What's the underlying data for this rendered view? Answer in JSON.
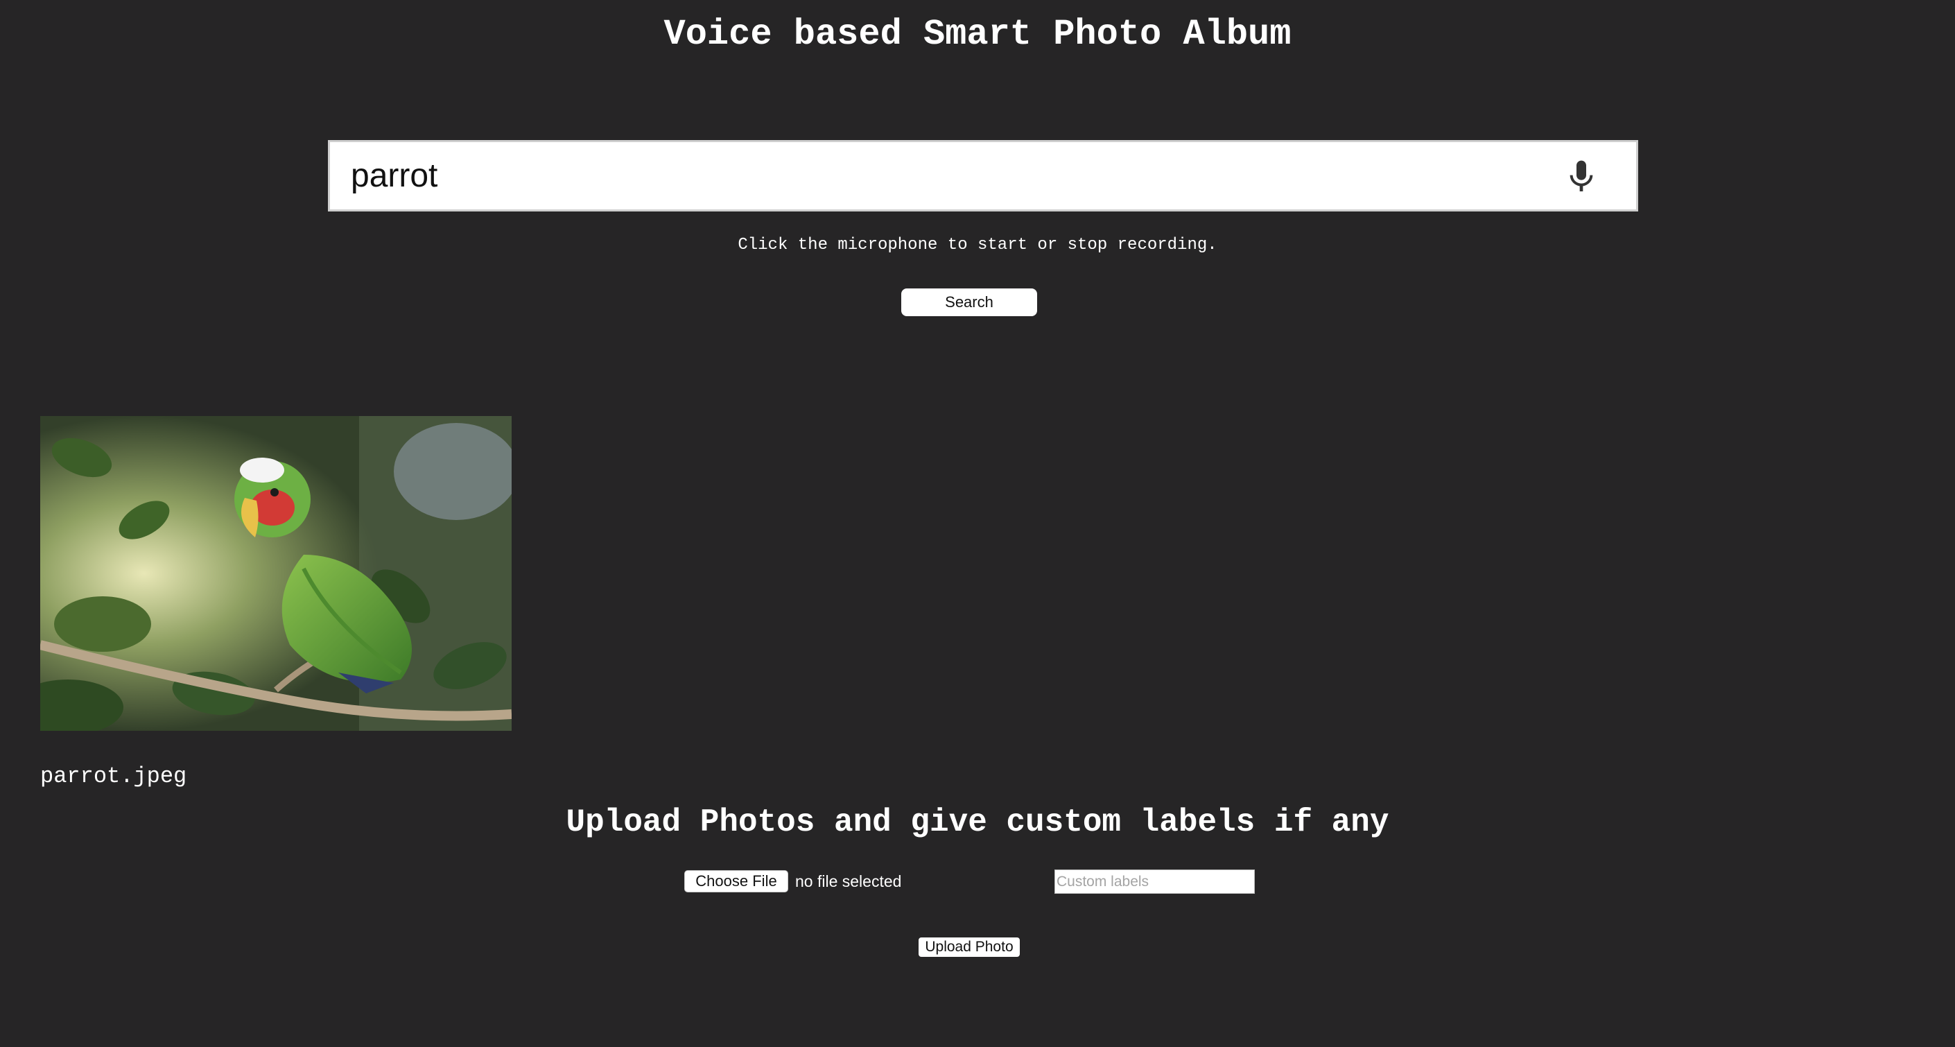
{
  "page": {
    "title": "Voice based Smart Photo Album"
  },
  "search": {
    "value": "parrot",
    "mic_icon": "microphone-icon",
    "hint": "Click the microphone to start or stop recording.",
    "button_label": "Search"
  },
  "results": [
    {
      "image": "parrot-photo",
      "filename": "parrot.jpeg"
    }
  ],
  "upload": {
    "title": "Upload Photos and give custom labels if any",
    "choose_file_label": "Choose File",
    "file_status": "no file selected",
    "labels_placeholder": "Custom labels",
    "button_label": "Upload Photo"
  },
  "colors": {
    "background": "#262526",
    "text": "#ffffff",
    "input_background": "#ffffff"
  }
}
